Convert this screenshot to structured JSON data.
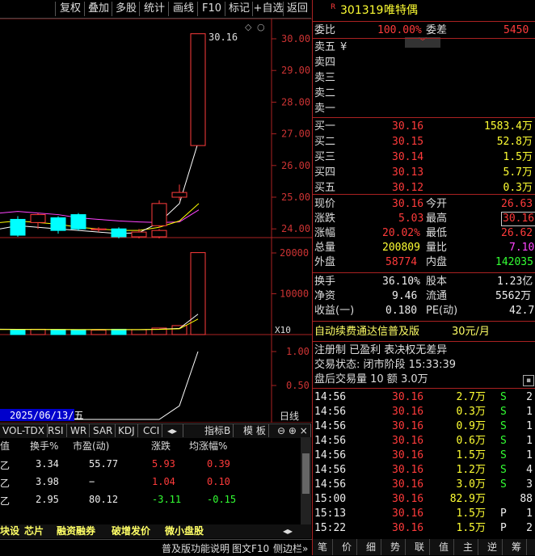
{
  "toolbar": {
    "items": [
      "复权",
      "叠加",
      "多股",
      "统计",
      "画线",
      "F10",
      "标记",
      "+自选",
      "返回"
    ]
  },
  "chart": {
    "price_ticks": [
      "30.00",
      "29.00",
      "28.00",
      "27.00",
      "26.00",
      "25.00",
      "24.00"
    ],
    "vol_ticks": [
      "20000",
      "10000"
    ],
    "vol_unit": "X10",
    "ind_ticks": [
      "1.00",
      "0.50"
    ],
    "peak_label": "30.16",
    "date_label": "2025/06/13/五",
    "period": "日线",
    "colors": {
      "up": "#ff3b3b",
      "down": "#00ffff",
      "ma_white": "#ffffff",
      "ma_yellow": "#ffff00",
      "ma_purple": "#ff44ff"
    }
  },
  "chart_data": {
    "type": "candlestick",
    "candles": [
      {
        "o": 24.3,
        "c": 23.8,
        "h": 24.4,
        "l": 23.75,
        "dir": "down"
      },
      {
        "o": 24.2,
        "c": 24.45,
        "h": 24.5,
        "l": 24.0,
        "dir": "up"
      },
      {
        "o": 24.35,
        "c": 23.95,
        "h": 24.4,
        "l": 23.85,
        "dir": "down"
      },
      {
        "o": 24.45,
        "c": 24.0,
        "h": 24.5,
        "l": 23.95,
        "dir": "down"
      },
      {
        "o": 24.0,
        "c": 23.97,
        "h": 24.05,
        "l": 23.9,
        "dir": "up"
      },
      {
        "o": 24.0,
        "c": 23.75,
        "h": 24.05,
        "l": 23.7,
        "dir": "down"
      },
      {
        "o": 23.75,
        "c": 23.9,
        "h": 24.0,
        "l": 23.7,
        "dir": "up"
      },
      {
        "o": 23.75,
        "c": 23.95,
        "h": 24.0,
        "l": 23.7,
        "dir": "up"
      },
      {
        "o": 24.1,
        "c": 24.8,
        "h": 24.9,
        "l": 24.05,
        "dir": "up"
      },
      {
        "o": 25.0,
        "c": 25.15,
        "h": 25.4,
        "l": 24.9,
        "dir": "up"
      },
      {
        "o": 26.63,
        "c": 30.16,
        "h": 30.16,
        "l": 26.62,
        "dir": "up"
      }
    ],
    "volumes": [
      1200,
      1300,
      1250,
      1200,
      1100,
      1300,
      1200,
      1200,
      1600,
      2200,
      20080
    ],
    "indicator": [
      0,
      0,
      0,
      0,
      0,
      0,
      0,
      0,
      0,
      0.2,
      1.0
    ]
  },
  "ind_tabs": [
    "VOL-TDX",
    "RSI",
    "WR",
    "SAR",
    "KDJ",
    "CCI",
    "指标B",
    "模 板"
  ],
  "sector": {
    "headers": [
      "值",
      "换手%",
      "市盈(动)",
      "涨跌",
      "均涨幅%"
    ],
    "rows": [
      {
        "c0": "乙",
        "turnover": "3.34",
        "pe": "55.77",
        "chg": "5.93",
        "avg": "0.39",
        "chg_dir": "up",
        "avg_dir": "up"
      },
      {
        "c0": "乙",
        "turnover": "3.98",
        "pe": "−",
        "chg": "1.04",
        "avg": "0.10",
        "chg_dir": "up",
        "avg_dir": "up"
      },
      {
        "c0": "乙",
        "turnover": "2.95",
        "pe": "80.12",
        "chg": "-3.11",
        "avg": "-0.15",
        "chg_dir": "down",
        "avg_dir": "down"
      }
    ]
  },
  "bottom_tabs": [
    "块设",
    "芯片",
    "融资融券",
    "破增发价",
    "微小盘股"
  ],
  "status": {
    "left": "普及版功能说明",
    "right": "图文F10",
    "r2": "侧边栏»"
  },
  "stock": {
    "badge": "R",
    "code": "301319",
    "name": "唯特偶"
  },
  "quote": {
    "wb_label": "委比",
    "wb": "100.00%",
    "wc_label": "委差",
    "wc": "5450",
    "sells": [
      {
        "l": "卖五",
        "p": "¥",
        "v": ""
      },
      {
        "l": "卖四",
        "p": "",
        "v": ""
      },
      {
        "l": "卖三",
        "p": "",
        "v": ""
      },
      {
        "l": "卖二",
        "p": "",
        "v": ""
      },
      {
        "l": "卖一",
        "p": "",
        "v": ""
      }
    ],
    "buys": [
      {
        "l": "买一",
        "p": "30.16",
        "v": "1583.4万"
      },
      {
        "l": "买二",
        "p": "30.15",
        "v": "52.8万"
      },
      {
        "l": "买三",
        "p": "30.14",
        "v": "1.5万"
      },
      {
        "l": "买四",
        "p": "30.13",
        "v": "5.7万"
      },
      {
        "l": "买五",
        "p": "30.12",
        "v": "0.3万"
      }
    ],
    "xj_label": "现价",
    "xj": "30.16",
    "jk_label": "今开",
    "jk": "26.63",
    "zd_label": "涨跌",
    "zd": "5.03",
    "zg_label": "最高",
    "zg": "30.16",
    "zf_label": "涨幅",
    "zf": "20.02%",
    "zdi_label": "最低",
    "zdi": "26.62",
    "zl_label": "总量",
    "zl": "200809",
    "lb_label": "量比",
    "lb": "7.10",
    "wp_label": "外盘",
    "wp": "58774",
    "np_label": "内盘",
    "np": "142035",
    "hs_label": "换手",
    "hs": "36.10%",
    "gb_label": "股本",
    "gb": "1.23亿",
    "jz_label": "净资",
    "jz": "9.46",
    "lt_label": "流通",
    "lt": "5562万",
    "sy_label": "收益(一)",
    "sy": "0.180",
    "pe_label": "PE(动)",
    "pe": "42.7",
    "ad1": "自动续费通达信普及版",
    "ad2": "30元/月",
    "info": "注册制 已盈利 表决权无差异",
    "state": "交易状态: 闭市阶段 15:33:39",
    "after": "盘后交易量 10 额 3.0万"
  },
  "ticks": [
    {
      "t": "14:56",
      "p": "30.16",
      "v": "2.7万",
      "bs": "S",
      "n": "2"
    },
    {
      "t": "14:56",
      "p": "30.16",
      "v": "0.3万",
      "bs": "S",
      "n": "1"
    },
    {
      "t": "14:56",
      "p": "30.16",
      "v": "0.9万",
      "bs": "S",
      "n": "1"
    },
    {
      "t": "14:56",
      "p": "30.16",
      "v": "0.6万",
      "bs": "S",
      "n": "1"
    },
    {
      "t": "14:56",
      "p": "30.16",
      "v": "1.5万",
      "bs": "S",
      "n": "1"
    },
    {
      "t": "14:56",
      "p": "30.16",
      "v": "1.2万",
      "bs": "S",
      "n": "4"
    },
    {
      "t": "14:56",
      "p": "30.16",
      "v": "3.0万",
      "bs": "S",
      "n": "3"
    },
    {
      "t": "15:00",
      "p": "30.16",
      "v": "82.9万",
      "bs": "",
      "n": "88"
    },
    {
      "t": "15:13",
      "p": "30.16",
      "v": "1.5万",
      "bs": "P",
      "n": "1"
    },
    {
      "t": "15:22",
      "p": "30.16",
      "v": "1.5万",
      "bs": "P",
      "n": "2"
    }
  ],
  "right_tabs": [
    "笔",
    "价",
    "细",
    "势",
    "联",
    "值",
    "主",
    "逆",
    "筹"
  ]
}
